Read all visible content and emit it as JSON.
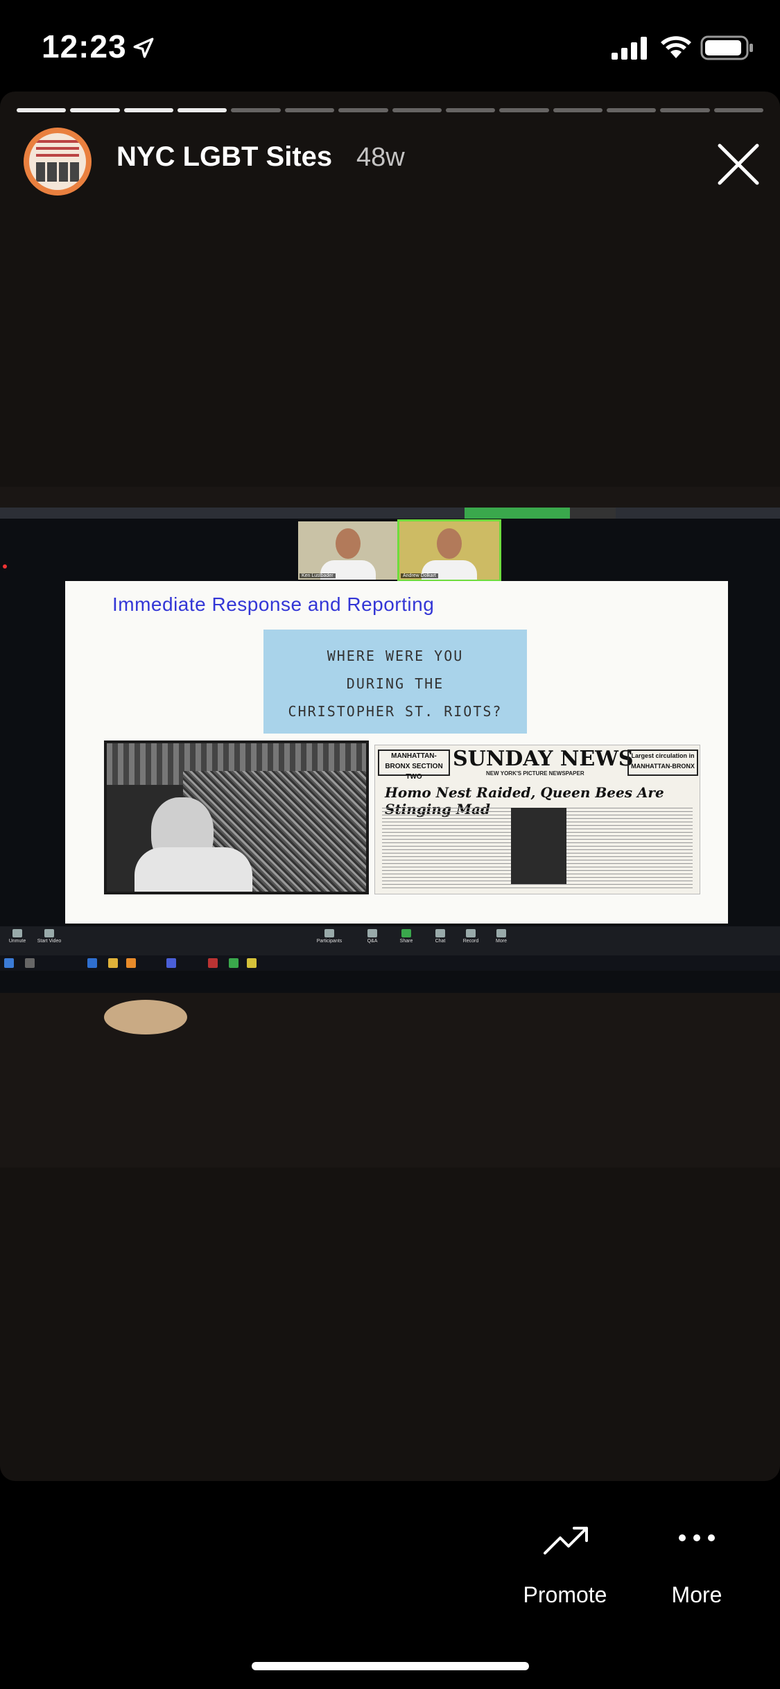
{
  "status_bar": {
    "time": "12:23"
  },
  "story": {
    "segments_total": 14,
    "segments_done": 4,
    "account_name": "NYC LGBT Sites",
    "age": "48w"
  },
  "slide": {
    "title": "Immediate Response and Reporting",
    "sign_lines": [
      "WHERE WERE YOU",
      "DURING THE",
      "CHRISTOPHER ST. RIOTS?"
    ],
    "newspaper": {
      "section": "MANHATTAN-BRONX SECTION TWO",
      "masthead": "SUNDAY NEWS",
      "subtitle": "NEW YORK'S PICTURE NEWSPAPER",
      "circulation": "Largest circulation in MANHATTAN-BRONX",
      "headline": "Homo Nest Raided, Queen Bees Are Stinging Mad"
    }
  },
  "zoom": {
    "participants": [
      "Ken Lustbader",
      "Andrew Dolkart"
    ],
    "controls": [
      "Unmute",
      "Start Video",
      "Participants",
      "Q&A",
      "Share",
      "Chat",
      "Record",
      "More"
    ]
  },
  "actions": {
    "promote_label": "Promote",
    "more_label": "More"
  }
}
